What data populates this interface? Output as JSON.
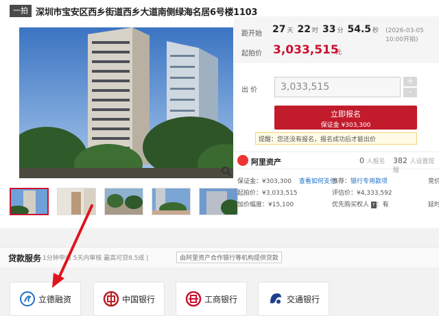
{
  "title": {
    "tag": "一拍",
    "text": "深圳市宝安区西乡街道西乡大道南侧绿海名居6号楼1103"
  },
  "countdown": {
    "label": "距开始",
    "days": "27",
    "days_unit": "天",
    "hours": "22",
    "hours_unit": "时",
    "minutes": "33",
    "minutes_unit": "分",
    "seconds": "54.5",
    "seconds_unit": "秒",
    "deadline": "(2026-03-05 10:00开拍)"
  },
  "start_price": {
    "label": "起拍价",
    "value": "3,033,515",
    "unit": "元"
  },
  "bid": {
    "label": "出 价",
    "value": "3,033,515",
    "plus": "+",
    "minus": "-"
  },
  "apply": {
    "label": "立即报名",
    "deposit": "保证金 ¥303,300"
  },
  "reminder": "提醒：您还没有报名，报名成功后才能出价",
  "platform": {
    "name": "阿里资产",
    "signup_count": "0",
    "signup_label": "人报名",
    "remind_count": "382",
    "remind_label": "人设置提醒"
  },
  "details": {
    "deposit": "保证金：¥303,300",
    "pay_link": "查看如何支付",
    "recommend": "推荐：",
    "loan_link": "银行专用款项",
    "start": "起拍价：¥3,033,515",
    "assess": "评估价：¥4,333,592",
    "bid_inc": "加价幅度：¥15,100",
    "priority": "优先购买权人",
    "priority_badge": "?",
    "priority_val": "：有",
    "cut1": "竞价",
    "cut2": "延时"
  },
  "loan": {
    "title": "贷款服务",
    "subtitle": "1分钟申请 5天内审核 最高可贷8.5成 |",
    "tag": "由阿里资产合作银行等机构提供贷款",
    "banks": [
      "立德融资",
      "中国银行",
      "工商银行",
      "交通银行"
    ]
  },
  "colors": {
    "accent": "#c21b2c",
    "link": "#1a6fc9"
  }
}
